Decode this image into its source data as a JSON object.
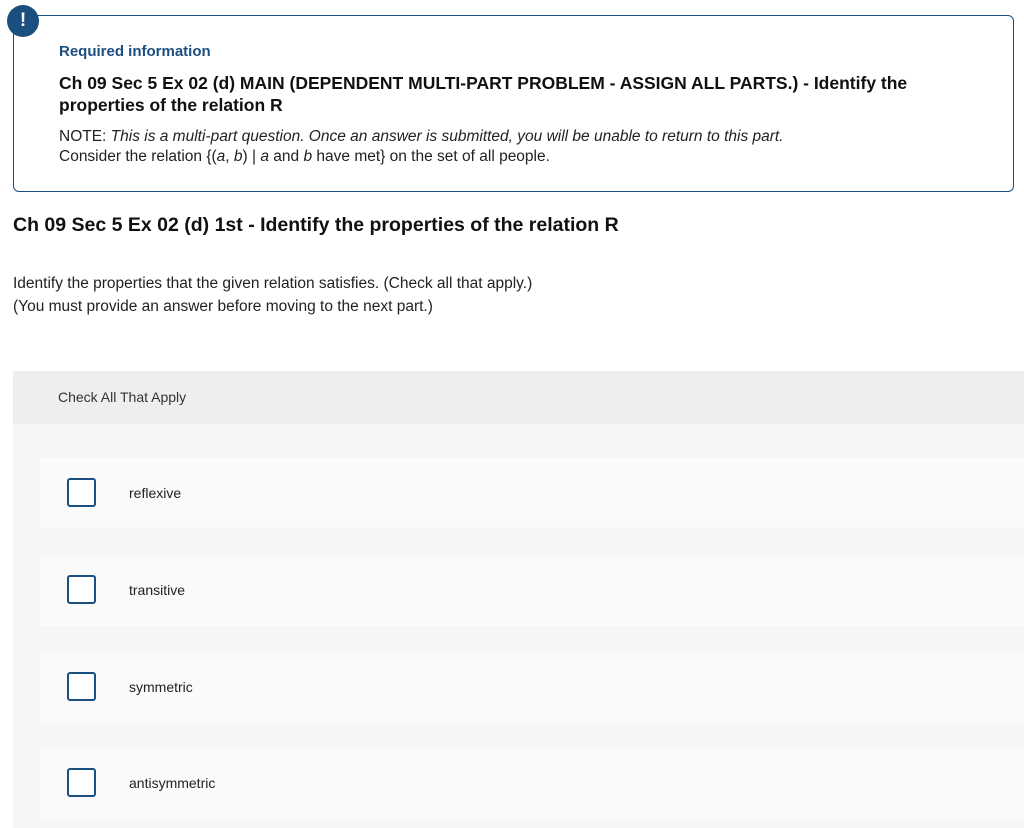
{
  "required_info": {
    "badge": "!",
    "label": "Required information",
    "title": "Ch 09 Sec 5 Ex 02 (d) MAIN (DEPENDENT MULTI-PART PROBLEM - ASSIGN ALL PARTS.) - Identify the properties of the relation R",
    "note_prefix": "NOTE: ",
    "note_italic": "This is a multi-part question. Once an answer is submitted, you will be unable to return to this part.",
    "relation_prefix": "Consider the relation {(",
    "relation_a": "a",
    "relation_comma": ", ",
    "relation_b": "b",
    "relation_mid": ") | ",
    "relation_a2": "a",
    "relation_and": " and ",
    "relation_b2": "b",
    "relation_suffix": " have met} on the set of all people."
  },
  "part_title": "Ch 09 Sec 5 Ex 02 (d) 1st - Identify the properties of the relation R",
  "instructions": {
    "line1": "Identify the properties that the given relation satisfies. (Check all that apply.)",
    "line2": "(You must provide an answer before moving to the next part.)"
  },
  "check_all": {
    "header": "Check All That Apply",
    "options": [
      {
        "label": "reflexive",
        "checked": false
      },
      {
        "label": "transitive",
        "checked": false
      },
      {
        "label": "symmetric",
        "checked": false
      },
      {
        "label": "antisymmetric",
        "checked": false
      }
    ]
  },
  "colors": {
    "accent": "#1b4f80",
    "panel_bg": "#f6f6f6",
    "header_bg": "#eeeeee"
  }
}
